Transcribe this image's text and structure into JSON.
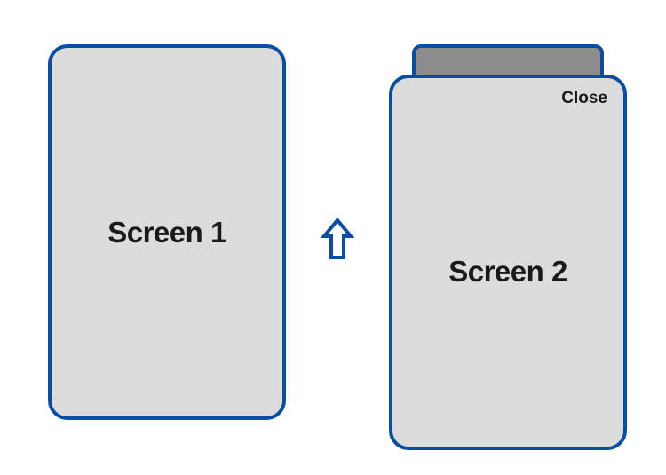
{
  "screens": {
    "left": {
      "title": "Screen 1"
    },
    "right": {
      "title": "Screen 2",
      "close_label": "Close"
    }
  },
  "arrow": {
    "name": "up-arrow-icon"
  },
  "colors": {
    "border": "#0a4ea3",
    "screen_fill": "#dcdcdc",
    "tab_fill": "#8c8c8c",
    "text": "#1a1a1a"
  }
}
